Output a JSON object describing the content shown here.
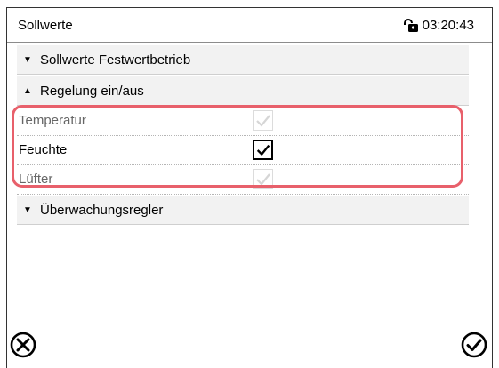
{
  "header": {
    "title": "Sollwerte",
    "time": "03:20:43",
    "lock_icon": "lock-icon"
  },
  "sections": [
    {
      "label": "Sollwerte Festwertbetrieb",
      "state": "collapsed"
    },
    {
      "label": "Regelung ein/aus",
      "state": "expanded"
    },
    {
      "label": "Überwachungsregler",
      "state": "collapsed"
    }
  ],
  "rows": [
    {
      "label": "Temperatur",
      "checked": true,
      "enabled": false
    },
    {
      "label": "Feuchte",
      "checked": true,
      "enabled": true
    },
    {
      "label": "Lüfter",
      "checked": true,
      "enabled": false
    }
  ],
  "footer": {
    "cancel_icon": "cancel-icon",
    "confirm_icon": "confirm-icon"
  },
  "colors": {
    "highlight": "#e8606b",
    "section_bg": "#f2f2f2"
  }
}
